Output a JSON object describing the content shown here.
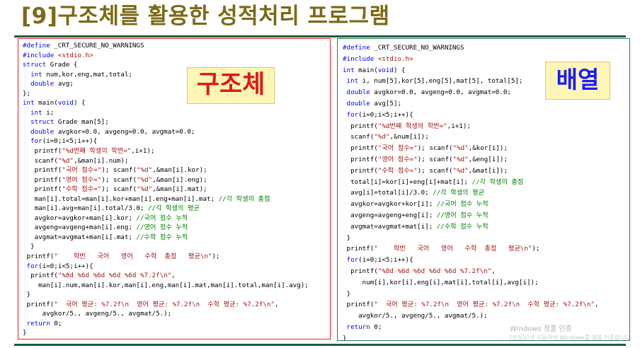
{
  "title": {
    "bracket": "[9]",
    "text": "구조체를 활용한 성적처리 프로그램"
  },
  "badges": {
    "left": "구조체",
    "right": "배열"
  },
  "left_code": [
    [
      [
        "pp",
        "#define"
      ],
      [
        "t",
        " _CRT_SECURE_NO_WARNINGS"
      ]
    ],
    [
      [
        "pp",
        "#include"
      ],
      [
        "t",
        " "
      ],
      [
        "str",
        "<stdio.h>"
      ]
    ],
    [
      [
        "kw",
        "struct"
      ],
      [
        "t",
        " Grade {"
      ]
    ],
    [
      [
        "t",
        "  "
      ],
      [
        "kw",
        "int"
      ],
      [
        "t",
        " num,kor,eng,mat,total;"
      ]
    ],
    [
      [
        "t",
        "  "
      ],
      [
        "kw",
        "double"
      ],
      [
        "t",
        " avg;"
      ]
    ],
    [
      [
        "t",
        "};"
      ]
    ],
    [
      [
        "kw",
        "int"
      ],
      [
        "t",
        " main("
      ],
      [
        "kw",
        "void"
      ],
      [
        "t",
        ") {"
      ]
    ],
    [
      [
        "t",
        "  "
      ],
      [
        "kw",
        "int"
      ],
      [
        "t",
        " i;"
      ]
    ],
    [
      [
        "t",
        "  "
      ],
      [
        "kw",
        "struct"
      ],
      [
        "t",
        " Grade man[5];"
      ]
    ],
    [
      [
        "t",
        "  "
      ],
      [
        "kw",
        "double"
      ],
      [
        "t",
        " avgkor=0.0, avgeng=0.0, avgmat=0.0;"
      ]
    ],
    [
      [
        "t",
        "  "
      ],
      [
        "kw",
        "for"
      ],
      [
        "t",
        "(i=0;i<5;i++){"
      ]
    ],
    [
      [
        "t",
        "   printf("
      ],
      [
        "str",
        "\"%d번째 학생의 학번=\""
      ],
      [
        "t",
        ",i+1);"
      ]
    ],
    [
      [
        "t",
        "   scanf("
      ],
      [
        "str",
        "\"%d\""
      ],
      [
        "t",
        ",&man[i].num);"
      ]
    ],
    [
      [
        "t",
        "   printf("
      ],
      [
        "str",
        "\"국어 점수=\""
      ],
      [
        "t",
        "); scanf("
      ],
      [
        "str",
        "\"%d\""
      ],
      [
        "t",
        ",&man[i].kor);"
      ]
    ],
    [
      [
        "t",
        "   printf("
      ],
      [
        "str",
        "\"영어 점수=\""
      ],
      [
        "t",
        "); scanf("
      ],
      [
        "str",
        "\"%d\""
      ],
      [
        "t",
        ",&man[i].eng);"
      ]
    ],
    [
      [
        "t",
        "   printf("
      ],
      [
        "str",
        "\"수학 점수=\""
      ],
      [
        "t",
        "); scanf("
      ],
      [
        "str",
        "\"%d\""
      ],
      [
        "t",
        ",&man[i].mat);"
      ]
    ],
    [
      [
        "t",
        "   man[i].total=man[i].kor+man[i].eng+man[i].mat; "
      ],
      [
        "cm",
        "//각 학생의 총점"
      ]
    ],
    [
      [
        "t",
        "   man[i].avg=man[i].total/3.0; "
      ],
      [
        "cm",
        "//각 학생의 평균"
      ]
    ],
    [
      [
        "t",
        "   avgkor=avgkor+man[i].kor; "
      ],
      [
        "cm",
        "//국어 점수 누적"
      ]
    ],
    [
      [
        "t",
        "   avgeng=avgeng+man[i].eng; "
      ],
      [
        "cm",
        "//영어 점수 누적"
      ]
    ],
    [
      [
        "t",
        "   avgmat=avgmat+man[i].mat; "
      ],
      [
        "cm",
        "//수학 점수 누적"
      ]
    ],
    [
      [
        "t",
        "  }"
      ]
    ],
    [
      [
        "t",
        " printf("
      ],
      [
        "str",
        "\"    학번   국어   영어   수학  총점   평균\\n\""
      ],
      [
        "t",
        ");"
      ]
    ],
    [
      [
        "t",
        " "
      ],
      [
        "kw",
        "for"
      ],
      [
        "t",
        "(i=0;i<5;i++){"
      ]
    ],
    [
      [
        "t",
        "  printf("
      ],
      [
        "str",
        "\"%8d %6d %6d %6d %6d %7.2f\\n\""
      ],
      [
        "t",
        ","
      ]
    ],
    [
      [
        "t",
        "    man[i].num,man[i].kor,man[i].eng,man[i].mat,man[i].total,man[i].avg);"
      ]
    ],
    [
      [
        "t",
        " }"
      ]
    ],
    [
      [
        "t",
        " printf("
      ],
      [
        "str",
        "\"  국어 평균: %7.2f\\n  영어 평균: %7.2f\\n  수학 평균: %7.2f\\n\""
      ],
      [
        "t",
        ","
      ]
    ],
    [
      [
        "t",
        "     avgkor/5., avgeng/5., avgmat/5.);"
      ]
    ],
    [
      [
        "t",
        " "
      ],
      [
        "kw",
        "return"
      ],
      [
        "t",
        " 0;"
      ]
    ],
    [
      [
        "t",
        "}"
      ]
    ]
  ],
  "right_code": [
    [
      [
        "pp",
        "#define"
      ],
      [
        "t",
        " _CRT_SECURE_NO_WARNINGS"
      ]
    ],
    [
      [
        "pp",
        "#include"
      ],
      [
        "t",
        " "
      ],
      [
        "str",
        "<stdio.h>"
      ]
    ],
    [
      [
        "kw",
        "int"
      ],
      [
        "t",
        " main("
      ],
      [
        "kw",
        "void"
      ],
      [
        "t",
        ") {"
      ]
    ],
    [
      [
        "t",
        " "
      ],
      [
        "kw",
        "int"
      ],
      [
        "t",
        " i, num[5],kor[5],eng[5],mat[5], total[5];"
      ]
    ],
    [
      [
        "t",
        " "
      ],
      [
        "kw",
        "double"
      ],
      [
        "t",
        " avgkor=0.0, avgeng=0.0, avgmat=0.0;"
      ]
    ],
    [
      [
        "t",
        " "
      ],
      [
        "kw",
        "double"
      ],
      [
        "t",
        " avg[5];"
      ]
    ],
    [
      [
        "t",
        " "
      ],
      [
        "kw",
        "for"
      ],
      [
        "t",
        "(i=0;i<5;i++){"
      ]
    ],
    [
      [
        "t",
        "  printf("
      ],
      [
        "str",
        "\"%d번째 학생의 학번=\""
      ],
      [
        "t",
        ",i+1);"
      ]
    ],
    [
      [
        "t",
        "  scanf("
      ],
      [
        "str",
        "\"%d\""
      ],
      [
        "t",
        ",&num[i]);"
      ]
    ],
    [
      [
        "t",
        "  printf("
      ],
      [
        "str",
        "\"국어 점수=\""
      ],
      [
        "t",
        "); scanf("
      ],
      [
        "str",
        "\"%d\""
      ],
      [
        "t",
        ",&kor[i]);"
      ]
    ],
    [
      [
        "t",
        "  printf("
      ],
      [
        "str",
        "\"영어 점수=\""
      ],
      [
        "t",
        "); scanf("
      ],
      [
        "str",
        "\"%d\""
      ],
      [
        "t",
        ",&eng[i]);"
      ]
    ],
    [
      [
        "t",
        "  printf("
      ],
      [
        "str",
        "\"수학 점수=\""
      ],
      [
        "t",
        "); scanf("
      ],
      [
        "str",
        "\"%d\""
      ],
      [
        "t",
        ",&mat[i]);"
      ]
    ],
    [
      [
        "t",
        "  total[i]=kor[i]+eng[i]+mat[i]; "
      ],
      [
        "cm",
        "//각 학생의 총점"
      ]
    ],
    [
      [
        "t",
        "  avg[i]=total[i]/3.0; "
      ],
      [
        "cm",
        "//각 학생의 평균"
      ]
    ],
    [
      [
        "t",
        "  avgkor=avgkor+kor[i]; "
      ],
      [
        "cm",
        "//국어 점수 누적"
      ]
    ],
    [
      [
        "t",
        "  avgeng=avgeng+eng[i]; "
      ],
      [
        "cm",
        "//영어 점수 누적"
      ]
    ],
    [
      [
        "t",
        "  avgmat=avgmat+mat[i]; "
      ],
      [
        "cm",
        "//수학 점수 누적"
      ]
    ],
    [
      [
        "t",
        " }"
      ]
    ],
    [
      [
        "t",
        " printf("
      ],
      [
        "str",
        "\"    학번   국어   영어   수학  총점   평균\\n\""
      ],
      [
        "t",
        ");"
      ]
    ],
    [
      [
        "t",
        " "
      ],
      [
        "kw",
        "for"
      ],
      [
        "t",
        "(i=0;i<5;i++){"
      ]
    ],
    [
      [
        "t",
        "  printf("
      ],
      [
        "str",
        "\"%8d %6d %6d %6d %6d %7.2f\\n\""
      ],
      [
        "t",
        ","
      ]
    ],
    [
      [
        "t",
        "     num[i],kor[i],eng[i],mat[i],total[i],avg[i]);"
      ]
    ],
    [
      [
        "t",
        " }"
      ]
    ],
    [
      [
        "t",
        " printf("
      ],
      [
        "str",
        "\"  국어 평균: %7.2f\\n  영어 평균: %7.2f\\n  수학 평균: %7.2f\\n\""
      ],
      [
        "t",
        ","
      ]
    ],
    [
      [
        "t",
        "    avgkor/5., avgeng/5., avgmat/5.);"
      ]
    ],
    [
      [
        "t",
        " "
      ],
      [
        "kw",
        "return"
      ],
      [
        "t",
        " 0;"
      ]
    ],
    [
      [
        "t",
        "}"
      ]
    ]
  ],
  "watermark": {
    "line1": "Windows 정품 인증",
    "line2": "[설정]으로 이동하여 Windows를 정품 인증합니다."
  },
  "colors": {
    "title": "#7a6a14",
    "left_border": "#e0262b",
    "right_border": "#2a7a5e",
    "keyword": "#0000ff",
    "string": "#a31515",
    "comment": "#008000",
    "badge_bg": "#fdf6b6"
  }
}
